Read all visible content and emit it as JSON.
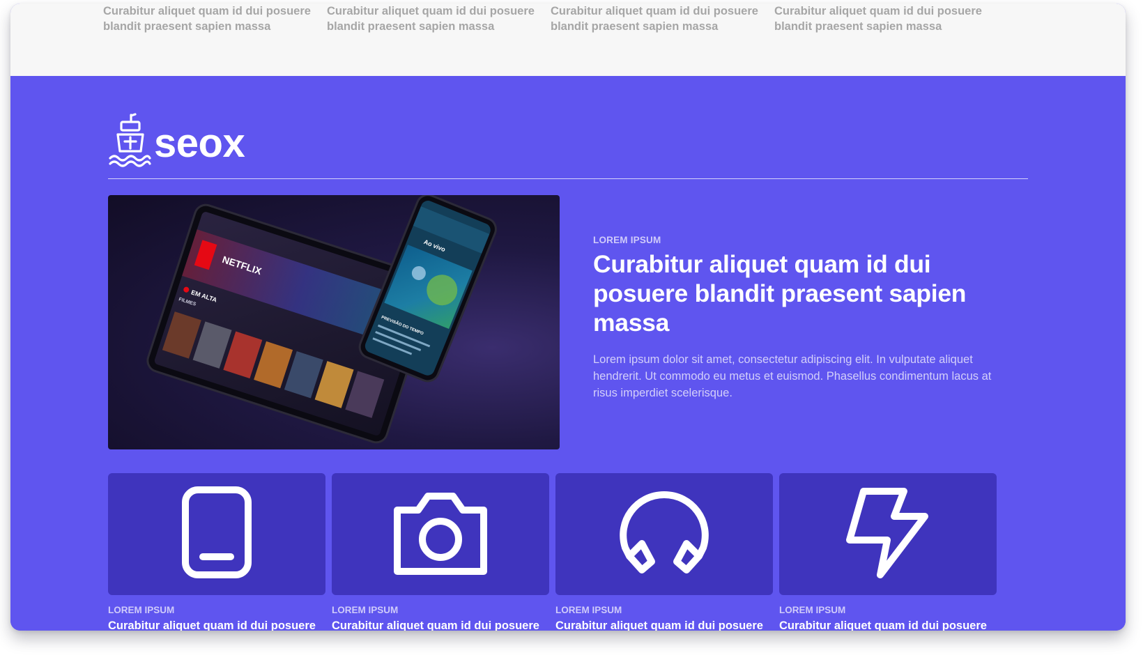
{
  "top_strip": {
    "columns": [
      {
        "text": "Curabitur aliquet quam id dui posuere blandit praesent sapien massa"
      },
      {
        "text": "Curabitur aliquet quam id dui posuere blandit praesent sapien massa"
      },
      {
        "text": "Curabitur aliquet quam id dui posuere blandit praesent sapien massa"
      },
      {
        "text": "Curabitur aliquet quam id dui posuere blandit praesent sapien massa"
      }
    ]
  },
  "brand": {
    "name": "seox",
    "icon": "ship-icon"
  },
  "hero": {
    "image_icon": "device-mockup-image",
    "eyebrow": "LOREM IPSUM",
    "headline": "Curabitur aliquet quam id dui posuere blandit praesent sapien massa",
    "body": "Lorem ipsum dolor sit amet, consectetur adipiscing elit. In vulputate aliquet hendrerit. Ut commodo eu metus et euismod. Phasellus condimentum lacus at risus imperdiet scelerisque.",
    "image_text": {
      "brand": "NETFLIX",
      "row": "EM ALTA",
      "sub": "FILMES",
      "phone_title": "Ao vivo",
      "phone_section": "PREVISÃO DO TEMPO"
    }
  },
  "cards": [
    {
      "icon": "smartphone-icon",
      "eyebrow": "LOREM IPSUM",
      "title": "Curabitur aliquet quam id dui posuere"
    },
    {
      "icon": "camera-icon",
      "eyebrow": "LOREM IPSUM",
      "title": "Curabitur aliquet quam id dui posuere"
    },
    {
      "icon": "headphones-icon",
      "eyebrow": "LOREM IPSUM",
      "title": "Curabitur aliquet quam id dui posuere"
    },
    {
      "icon": "lightning-icon",
      "eyebrow": "LOREM IPSUM",
      "title": "Curabitur aliquet quam id dui posuere"
    }
  ],
  "colors": {
    "accent": "#5f55ef",
    "card": "#3f34bd",
    "strip": "#f7f7f7",
    "muted_text": "#a6a6a6"
  }
}
